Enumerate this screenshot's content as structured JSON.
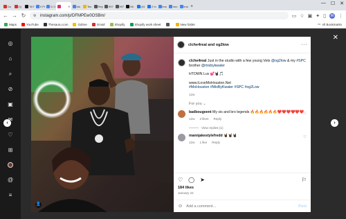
{
  "browser": {
    "tabs": [
      {
        "label": "Do",
        "color": "#d93025"
      },
      {
        "label": "(1)",
        "color": "#d93025"
      },
      {
        "label": "TikT",
        "color": "#111111"
      },
      {
        "label": "X Pr",
        "color": "#4285f4"
      },
      {
        "label": "G 2 in",
        "color": "#4285f4"
      },
      {
        "label": "",
        "color": "#e1306c",
        "active": true
      },
      {
        "label": "Ido",
        "color": "#4285f4"
      },
      {
        "label": "Tes",
        "color": "#f4b400"
      },
      {
        "label": "Rep",
        "color": "#555555"
      },
      {
        "label": "997",
        "color": "#555555"
      },
      {
        "label": "997",
        "color": "#555555"
      },
      {
        "label": "Nh",
        "color": "#111111"
      },
      {
        "label": "(24",
        "color": "#1877f2"
      },
      {
        "label": "2 In",
        "color": "#1877f2"
      },
      {
        "label": "imo",
        "color": "#4285f4"
      },
      {
        "label": "imo",
        "color": "#4285f4"
      },
      {
        "label": "imo",
        "color": "#4285f4"
      }
    ],
    "url": "instagram.com/p/DFMPEw0OSBm/",
    "bookmarks": [
      {
        "label": "Maps",
        "color": "#34a853"
      },
      {
        "label": "YouTube",
        "color": "#ff0000"
      },
      {
        "label": "Thesauru.com",
        "color": "#333333"
      },
      {
        "label": "Gdrive",
        "color": "#fbbc04"
      },
      {
        "label": "Gmail",
        "color": "#d93025"
      },
      {
        "label": "Shopify",
        "color": "#95bf47"
      },
      {
        "label": "Shopify work sheet",
        "color": "#0f9d58"
      },
      {
        "label": "",
        "color": "#555555"
      },
      {
        "label": "New folder",
        "color": "#f4b400"
      }
    ],
    "all_bookmarks": "All Bookmarks"
  },
  "post": {
    "header_user": "clche4real and og2low",
    "caption": {
      "user": "clche4real",
      "text_prefix": "Just in the studio with a few young Vets",
      "mention1": "@og2low",
      "amp": "& my",
      "tag1": "#SPC",
      "text_mid": "brother",
      "mention2": "@mixbykwater",
      "line2": "HTOWN Luv 💕🤘🏿🎵",
      "link": "www.iLoveMoHouston.Net",
      "hashtags": "#MoHouston #MixByKwater #SPC #og2Low"
    },
    "caption_time": "12w",
    "for_you": "For you",
    "comments": [
      {
        "user": "badbougeent",
        "text": "My sis and bro legends 🔥🔥🔥🔥🔥🔥❤️❤️❤️❤️❤️❤️",
        "time": "12w",
        "likes": "2 likes",
        "reply": "Reply",
        "view_replies": "View replies (1)",
        "avatar_color": "#c0713f"
      },
      {
        "user": "mannjakestylefredd",
        "text": "🤘🏿🤘🏿🤘🏿",
        "time": "12w",
        "likes": "1 like",
        "reply": "Reply",
        "avatar_color": "#9a9aa2"
      }
    ],
    "likes": "184 likes",
    "date": "January 24",
    "add_comment_placeholder": "Add a comment...",
    "post_label": "Post"
  },
  "icons": {
    "more": "more-horizontal-icon",
    "heart": "heart-icon",
    "comment": "comment-icon",
    "share": "share-icon",
    "save": "bookmark-icon",
    "emoji": "emoji-icon",
    "close": "close-icon",
    "prev": "chevron-left-icon",
    "next": "chevron-right-icon"
  }
}
